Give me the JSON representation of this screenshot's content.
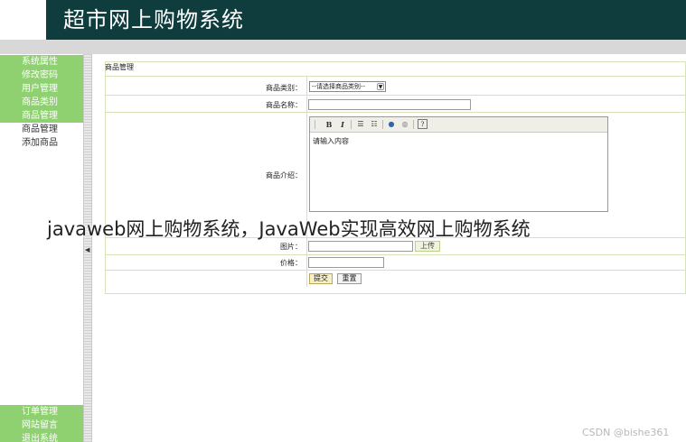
{
  "header": {
    "title": "超市网上购物系统"
  },
  "sidebar": {
    "top_items": [
      {
        "label": "系统属性",
        "highlight": true
      },
      {
        "label": "修改密码",
        "highlight": true
      },
      {
        "label": "用户管理",
        "highlight": true
      },
      {
        "label": "商品类别",
        "highlight": true
      },
      {
        "label": "商品管理",
        "highlight": true
      },
      {
        "label": "商品管理",
        "highlight": false
      },
      {
        "label": "添加商品",
        "highlight": false
      }
    ],
    "bottom_items": [
      {
        "label": "订单管理"
      },
      {
        "label": "网站留言"
      },
      {
        "label": "退出系统"
      }
    ],
    "highlight_color": "#8fd070"
  },
  "form": {
    "panel_title": "商品管理",
    "category_label": "商品类别：",
    "category_selected": "--请选择商品类别--",
    "name_label": "商品名称：",
    "intro_label": "商品介绍：",
    "editor_placeholder": "请输入内容",
    "image_label": "图片：",
    "upload_label": "上传",
    "price_label": "价格：",
    "submit_label": "提交",
    "reset_label": "重置"
  },
  "overlay": {
    "caption": "javaweb网上购物系统，JavaWeb实现高效网上购物系统",
    "credit": "CSDN @bishe361"
  },
  "colors": {
    "header": "#0f3d3d",
    "table_border": "#d6e2b8"
  }
}
